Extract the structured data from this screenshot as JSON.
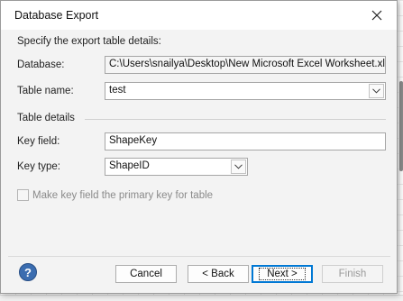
{
  "dialog": {
    "title": "Database Export",
    "instructions": "Specify the export table details:"
  },
  "fields": {
    "database_label": "Database:",
    "database_value": "C:\\Users\\snailya\\Desktop\\New Microsoft Excel Worksheet.xlsx",
    "table_name_label": "Table name:",
    "table_name_value": "test",
    "table_details_label": "Table details",
    "key_field_label": "Key field:",
    "key_field_value": "ShapeKey",
    "key_type_label": "Key type:",
    "key_type_value": "ShapeID"
  },
  "checkbox": {
    "label": "Make key field the primary key for table",
    "checked": false,
    "enabled": false
  },
  "buttons": {
    "help": "?",
    "cancel": "Cancel",
    "back": "< Back",
    "next": "Next >",
    "finish": "Finish"
  },
  "icons": {
    "close": "close-icon",
    "help": "help-icon",
    "dropdown": "chevron-down-icon"
  },
  "colors": {
    "help_icon": "#3b6db0",
    "default_button_border": "#0078d4"
  }
}
